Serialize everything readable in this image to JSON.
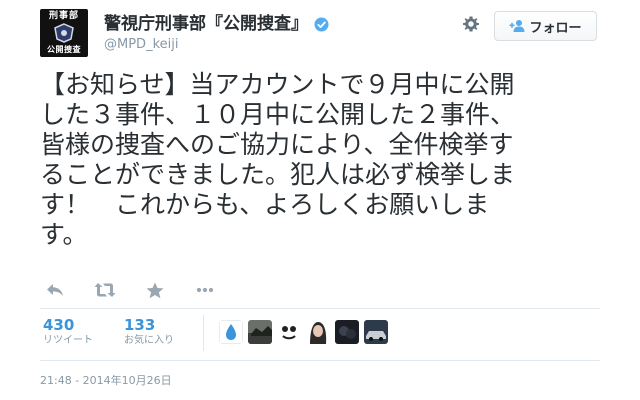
{
  "account": {
    "avatar_text_top": "刑事部",
    "avatar_text_bottom": "公開捜査",
    "display_name": "警視庁刑事部『公開捜査』",
    "screen_name": "@MPD_keiji",
    "verified_icon": "verified-badge-icon"
  },
  "header": {
    "settings_icon": "gear-icon",
    "follow_icon": "person-add-icon",
    "follow_label": "フォロー"
  },
  "tweet": {
    "lines": [
      "【お知らせ】当アカウントで９月中に公開",
      "した３事件、１０月中に公開した２事件、",
      "皆様の捜査へのご協力により、全件検挙す",
      "ることができました。犯人は必ず検挙しま",
      "す！　これからも、よろしくお願いしま",
      "す。"
    ]
  },
  "actions": {
    "reply_icon": "reply-icon",
    "retweet_icon": "retweet-icon",
    "favorite_icon": "star-icon",
    "more_icon": "more-icon"
  },
  "stats": {
    "retweets": {
      "value": "430",
      "label": "リツイート"
    },
    "favorites": {
      "value": "133",
      "label": "お気に入り"
    }
  },
  "timestamp": "21:48 - 2014年10月26日",
  "colors": {
    "accent": "#3b94d9",
    "text": "#292f33",
    "muted": "#8899a6",
    "border": "#e1e8ed",
    "verified": "#55acee",
    "icons": "#9aa7b2"
  }
}
